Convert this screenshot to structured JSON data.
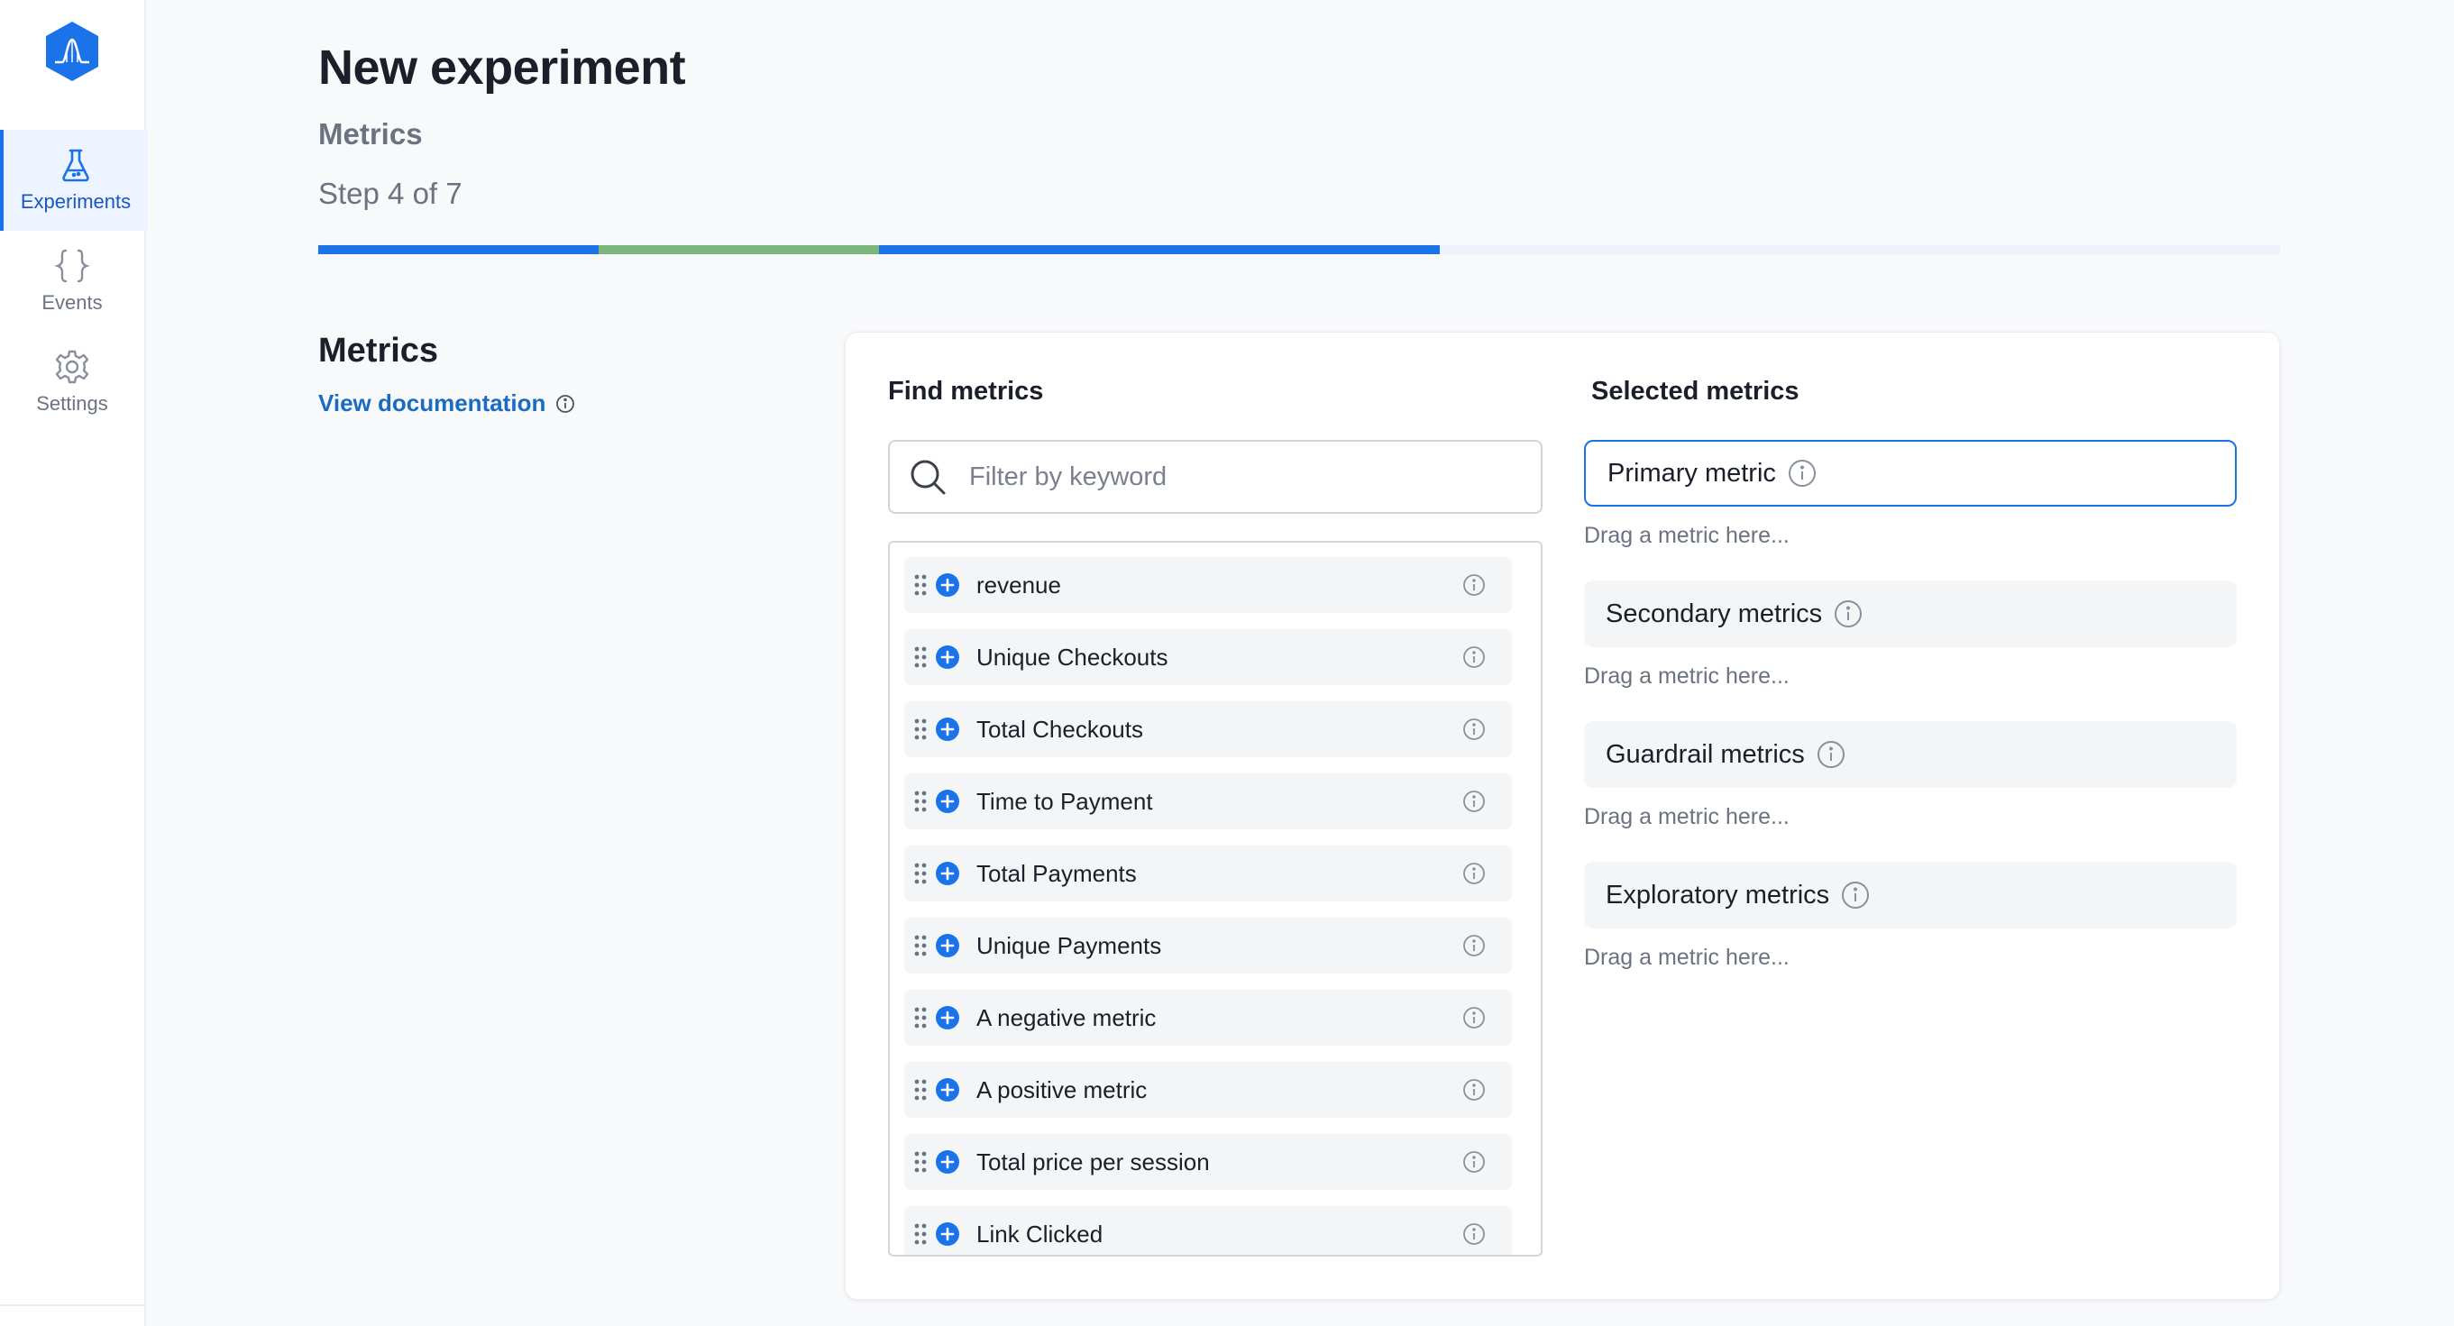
{
  "sidebar": {
    "items": [
      {
        "label": "Experiments",
        "icon": "flask-icon",
        "active": true
      },
      {
        "label": "Events",
        "icon": "braces-icon",
        "active": false
      },
      {
        "label": "Settings",
        "icon": "gear-icon",
        "active": false
      }
    ]
  },
  "header": {
    "title": "New experiment",
    "subtitle": "Metrics",
    "step": "Step 4 of 7"
  },
  "progress": {
    "segments": [
      {
        "fraction": 0.1429,
        "color": "#1a73e8"
      },
      {
        "fraction": 0.1429,
        "color": "#7ab57a"
      },
      {
        "fraction": 0.2857,
        "color": "#1a73e8"
      },
      {
        "fraction": 0.4285,
        "color": "#eef2f9"
      }
    ]
  },
  "section": {
    "title": "Metrics",
    "doc_link": "View documentation"
  },
  "find": {
    "title": "Find metrics",
    "search_placeholder": "Filter by keyword",
    "items": [
      "revenue",
      "Unique Checkouts",
      "Total Checkouts",
      "Time to Payment",
      "Total Payments",
      "Unique Payments",
      "A negative metric",
      "A positive metric",
      "Total price per session",
      "Link Clicked"
    ]
  },
  "selected": {
    "title": "Selected metrics",
    "slots": [
      {
        "label": "Primary metric",
        "hint": "Drag a metric here..."
      },
      {
        "label": "Secondary metrics",
        "hint": "Drag a metric here..."
      },
      {
        "label": "Guardrail metrics",
        "hint": "Drag a metric here..."
      },
      {
        "label": "Exploratory metrics",
        "hint": "Drag a metric here..."
      }
    ]
  },
  "colors": {
    "accent": "#1a73e8",
    "success": "#7ab57a",
    "link": "#1a6bc4"
  }
}
